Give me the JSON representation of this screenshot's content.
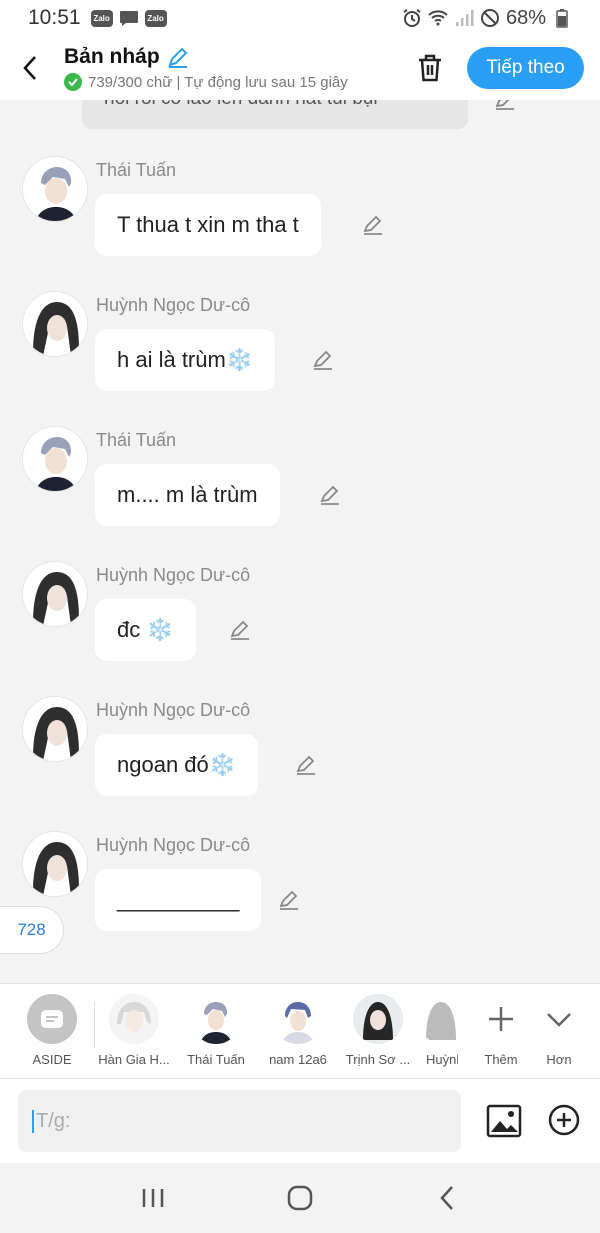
{
  "status_bar": {
    "time": "10:51",
    "battery": "68%",
    "notif_zalo_1": "Zalo",
    "notif_zalo_2": "Zalo"
  },
  "header": {
    "title": "Bản nháp",
    "subtitle": "739/300 chữ | Tự động lưu sau 15 giây",
    "next_label": "Tiếp theo"
  },
  "partial_message": {
    "text": "nói rồi có láo lên đánh nát tui bụi"
  },
  "messages": [
    {
      "sender": "Thái Tuấn",
      "text": "T thua t xin m tha t"
    },
    {
      "sender": "Huỳnh Ngọc Dư-cô",
      "text": "h ai là trùm❄️"
    },
    {
      "sender": "Thái Tuấn",
      "text": "m.... m là trùm"
    },
    {
      "sender": "Huỳnh Ngọc Dư-cô",
      "text": "đc ❄️"
    },
    {
      "sender": "Huỳnh Ngọc Dư-cô",
      "text": "ngoan đó❄️"
    },
    {
      "sender": "Huỳnh Ngọc Dư-cô",
      "text": "__________"
    }
  ],
  "counter": "728",
  "characters": [
    {
      "label": "ASIDE"
    },
    {
      "label": "Hàn Gia H..."
    },
    {
      "label": "Thái Tuấn"
    },
    {
      "label": "nam 12a6"
    },
    {
      "label": "Trịnh Sơ ..."
    },
    {
      "label": "Huỳnh"
    }
  ],
  "tools": {
    "add_label": "Thêm",
    "more_label": "Hơn"
  },
  "input": {
    "placeholder": "T/g:"
  },
  "colors": {
    "accent": "#2a9df4",
    "check": "#3bb84a",
    "bubble": "#ffffff",
    "background": "#f3f3f3"
  }
}
